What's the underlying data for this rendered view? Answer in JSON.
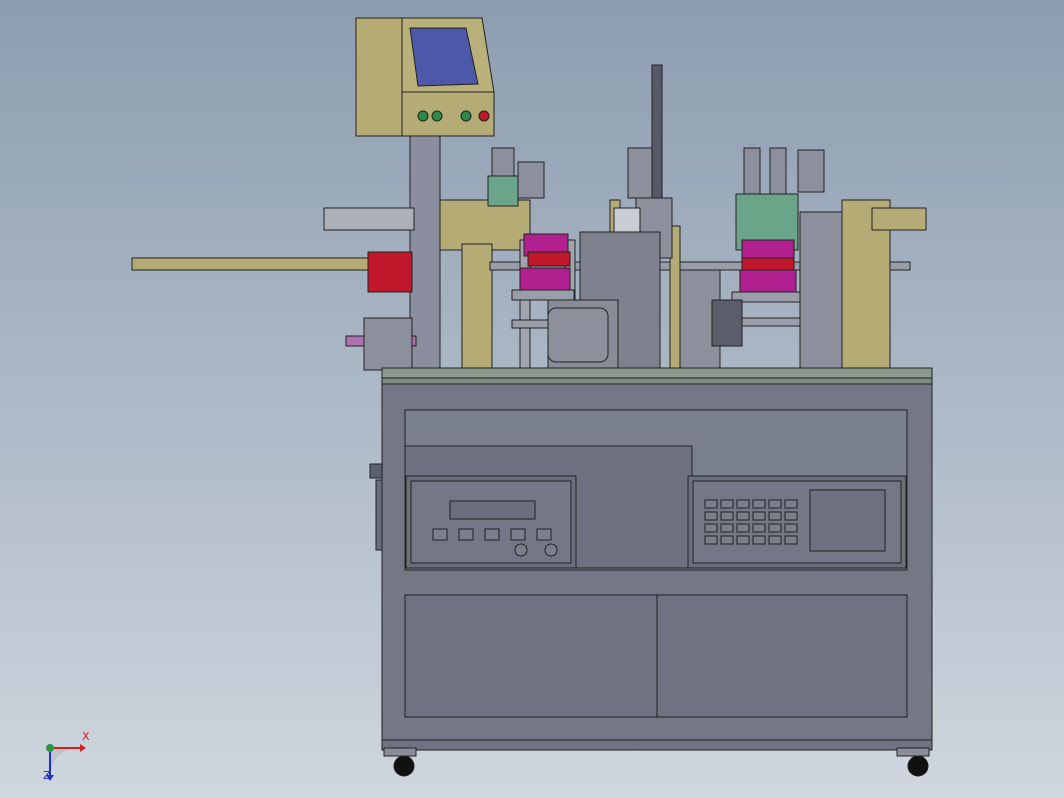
{
  "scene": {
    "subject": "cad-assembly-machine-front-view",
    "colors": {
      "background_top": "#8d9db0",
      "background_bottom": "#cfd6df",
      "cabinet": "#747886",
      "panel": "#6e7281",
      "frame_olive": "#b5ac75",
      "accent_red": "#c0182a",
      "accent_magenta": "#b0208e",
      "accent_green": "#6aa58a",
      "screen_blue": "#4e58a8"
    }
  },
  "axis_triad": {
    "x_label": "X",
    "z_label": "Z"
  }
}
